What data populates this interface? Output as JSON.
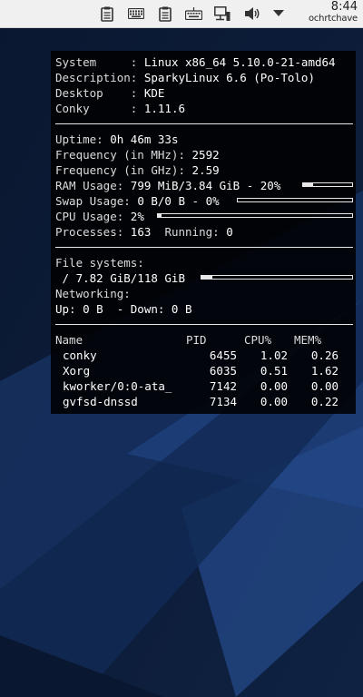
{
  "panel": {
    "time": "8:44",
    "date": "ochrtchave"
  },
  "colors": {
    "panel_bg": "#f0f0f0",
    "conky_bg": "#000000",
    "conky_text": "#dcdcdc",
    "wall_dark": "#0a1428",
    "wall_blue": "#1f3f78"
  },
  "icons": [
    "clipboard-icon",
    "keyboard-layout-icon",
    "clipboard-icon",
    "keyboard-icon",
    "network-icon",
    "volume-icon",
    "arrow-down-icon"
  ],
  "conky": {
    "system": [
      {
        "label": "System     :",
        "value": "Linux x86_64 5.10.0-21-amd64"
      },
      {
        "label": "Description:",
        "value": "SparkyLinux 6.6 (Po-Tolo)"
      },
      {
        "label": "Desktop    :",
        "value": "KDE"
      },
      {
        "label": "Conky      :",
        "value": "1.11.6"
      }
    ],
    "uptime": {
      "label": "Uptime:",
      "value": "0h 46m 33s"
    },
    "freq_mhz": {
      "label": "Frequency (in MHz):",
      "value": "2592"
    },
    "freq_ghz": {
      "label": "Frequency (in GHz):",
      "value": "2.59"
    },
    "ram": {
      "label": "RAM Usage:",
      "value": "799 MiB/3.84 GiB - 20%",
      "percent": 20
    },
    "swap": {
      "label": "Swap Usage:",
      "value": "0 B/0 B - 0%",
      "percent": 0
    },
    "cpu": {
      "label": "CPU Usage:",
      "value": "2%",
      "percent": 2
    },
    "processes": {
      "label": "Processes:",
      "value": "163",
      "running_label": "Running:",
      "running_value": "0"
    },
    "filesystems": {
      "label": "File systems:",
      "value": " / 7.82 GiB/118 GiB",
      "percent": 7
    },
    "networking": {
      "label": "Networking:",
      "value": "Up: 0 B  - Down: 0 B"
    },
    "proc_table": {
      "headers": [
        "Name",
        "PID",
        "CPU%",
        "MEM%"
      ],
      "rows": [
        [
          "conky",
          "6455",
          "1.02",
          "0.26"
        ],
        [
          "Xorg",
          "6035",
          "0.51",
          "1.62"
        ],
        [
          "kworker/0:0-ata_",
          "7142",
          "0.00",
          "0.00"
        ],
        [
          "gvfsd-dnssd",
          "7134",
          "0.00",
          "0.22"
        ]
      ]
    }
  }
}
